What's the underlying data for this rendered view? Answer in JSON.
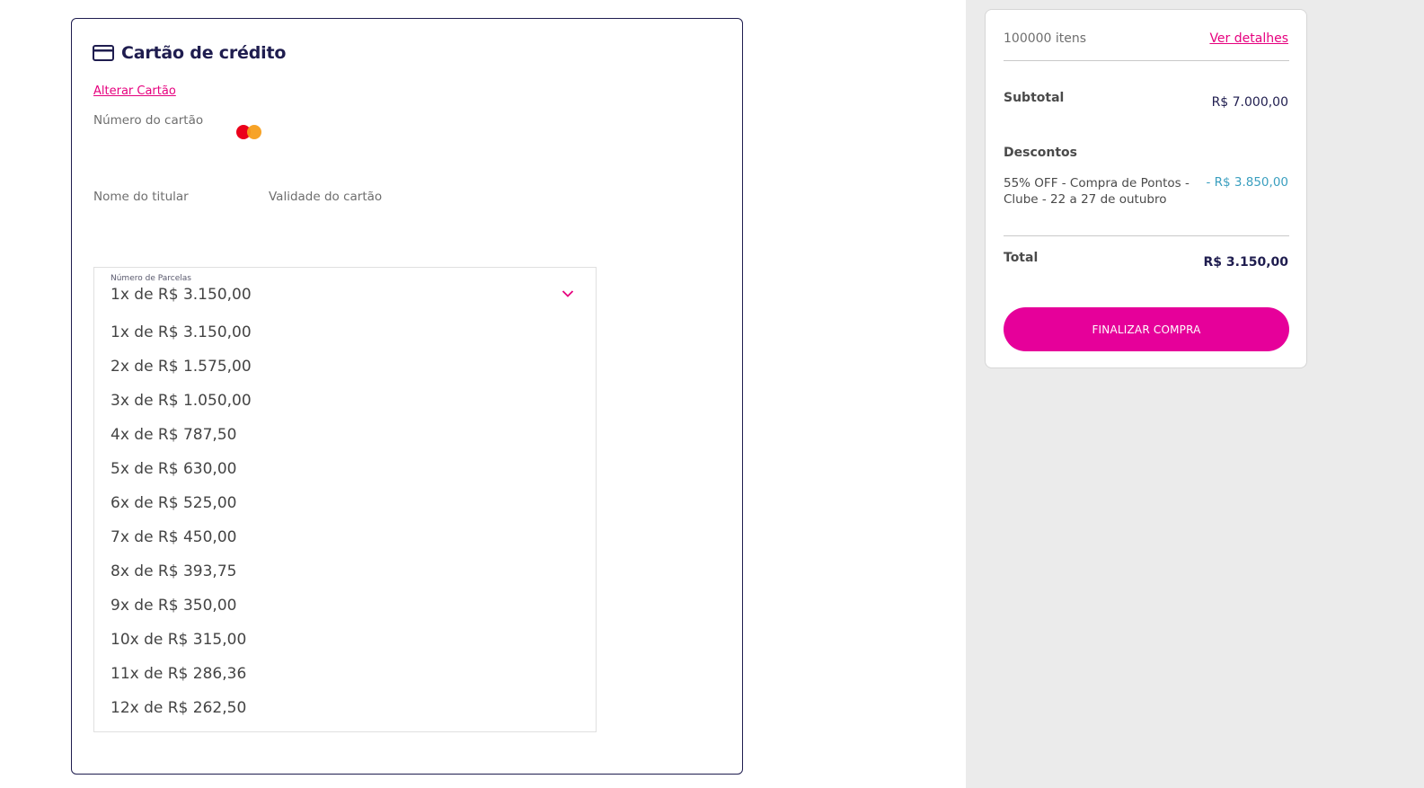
{
  "payment": {
    "title": "Cartão de crédito",
    "change_card_link": "Alterar Cartão",
    "card_number_label": "Número do cartão",
    "holder_name_label": "Nome do titular",
    "expiry_label": "Validade do cartão",
    "card_brand_icon": "mastercard-icon",
    "installments": {
      "label": "Número de Parcelas",
      "selected": "1x de R$ 3.150,00",
      "options": [
        "1x de R$ 3.150,00",
        "2x de R$ 1.575,00",
        "3x de R$ 1.050,00",
        "4x de R$ 787,50",
        "5x de R$ 630,00",
        "6x de R$ 525,00",
        "7x de R$ 450,00",
        "8x de R$ 393,75",
        "9x de R$ 350,00",
        "10x de R$ 315,00",
        "11x de R$ 286,36",
        "12x de R$ 262,50"
      ]
    }
  },
  "summary": {
    "items_count": "100000 itens",
    "details_link": "Ver detalhes",
    "subtotal_label": "Subtotal",
    "subtotal_value": "R$ 7.000,00",
    "discounts_label": "Descontos",
    "discount_description": "55% OFF - Compra de Pontos - Clube - 22 a 27 de outubro",
    "discount_value": "- R$ 3.850,00",
    "total_label": "Total",
    "total_value": "R$ 3.150,00",
    "finish_button": "FINALIZAR COMPRA"
  },
  "colors": {
    "brand_pink": "#e6007e",
    "navy": "#1f1d4f",
    "discount_blue": "#3a9fbf",
    "panel_bg": "#ebebeb"
  }
}
